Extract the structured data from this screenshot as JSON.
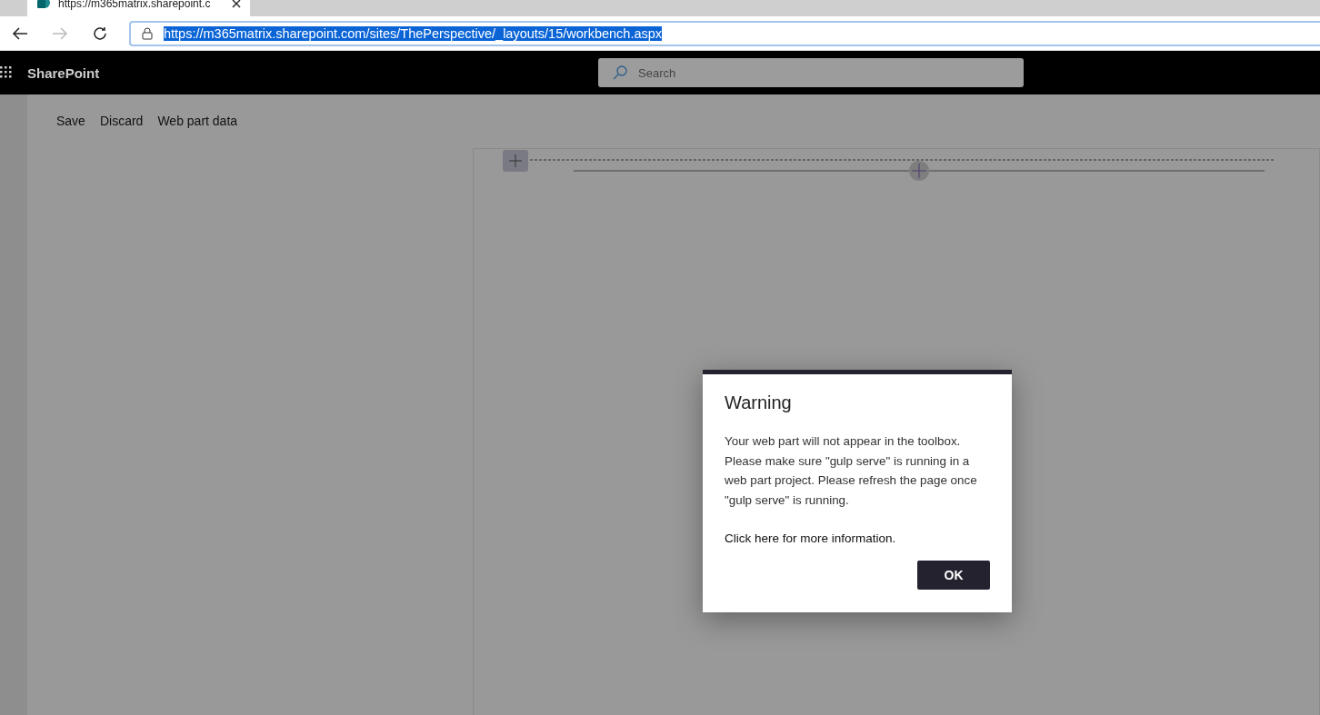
{
  "browser": {
    "tab_title": "https://m365matrix.sharepoint.c",
    "address": "https://m365matrix.sharepoint.com/sites/ThePerspective/_layouts/15/workbench.aspx",
    "address_selected": true
  },
  "suite_bar": {
    "title": "SharePoint",
    "search": {
      "placeholder": "Search"
    }
  },
  "command_bar": [
    "Save",
    "Discard",
    "Web part data"
  ],
  "dialog": {
    "title": "Warning",
    "message": "Your web part will not appear in the toolbox. Please make sure \"gulp serve\" is running in a web part project. Please refresh the page once \"gulp serve\" is running.",
    "link": "Click here for more information.",
    "button": "OK"
  }
}
